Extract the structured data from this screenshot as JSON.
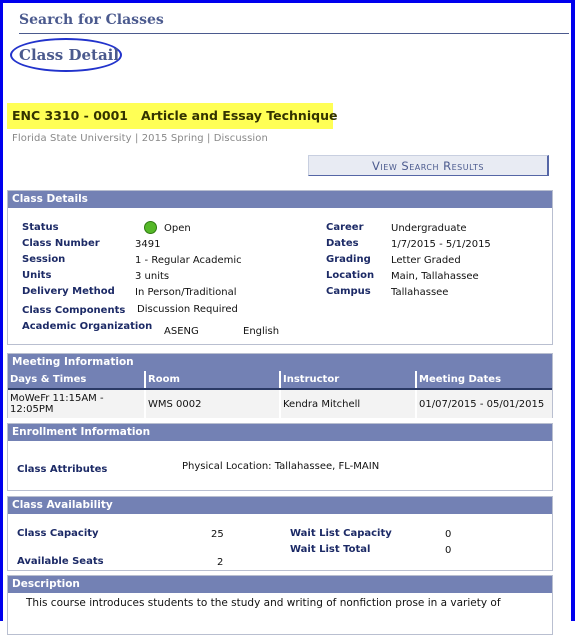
{
  "page": {
    "heading": "Search for Classes",
    "subheading": "Class Detail"
  },
  "course": {
    "title": "ENC 3310 - 0001   Article and Essay Technique",
    "subtitle": "Florida State University | 2015 Spring | Discussion"
  },
  "buttons": {
    "view_search_results": "View Search Results"
  },
  "class_details": {
    "header": "Class Details",
    "left": [
      {
        "label": "Status",
        "value": "Open"
      },
      {
        "label": "Class Number",
        "value": "3491"
      },
      {
        "label": "Session",
        "value": "1 - Regular Academic"
      },
      {
        "label": "Units",
        "value": "3 units"
      },
      {
        "label": "Delivery Method",
        "value": "In Person/Traditional"
      },
      {
        "label": "Class Components",
        "value": "Discussion Required"
      },
      {
        "label": "Academic Organization",
        "value": "ASENG",
        "value2": "English"
      }
    ],
    "right": [
      {
        "label": "Career",
        "value": "Undergraduate"
      },
      {
        "label": "Dates",
        "value": "1/7/2015 - 5/1/2015"
      },
      {
        "label": "Grading",
        "value": "Letter Graded"
      },
      {
        "label": "Location",
        "value": "Main, Tallahassee"
      },
      {
        "label": "Campus",
        "value": "Tallahassee"
      }
    ],
    "status_color": "#55b828"
  },
  "meeting_information": {
    "header": "Meeting Information",
    "columns": [
      "Days & Times",
      "Room",
      "Instructor",
      "Meeting Dates"
    ],
    "rows": [
      [
        "MoWeFr 11:15AM - 12:05PM",
        "WMS 0002",
        "Kendra Mitchell",
        "01/07/2015 - 05/01/2015"
      ]
    ]
  },
  "enrollment_information": {
    "header": "Enrollment Information",
    "class_attributes_label": "Class Attributes",
    "class_attributes_value": "Physical Location: Tallahassee, FL-MAIN"
  },
  "class_availability": {
    "header": "Class Availability",
    "class_capacity_label": "Class Capacity",
    "class_capacity": "25",
    "available_seats_label": "Available Seats",
    "available_seats": "2",
    "wait_list_capacity_label": "Wait List Capacity",
    "wait_list_capacity": "0",
    "wait_list_total_label": "Wait List Total",
    "wait_list_total": "0"
  },
  "description": {
    "header": "Description",
    "text": "This course introduces students to the study and writing of nonfiction prose in a variety of"
  }
}
